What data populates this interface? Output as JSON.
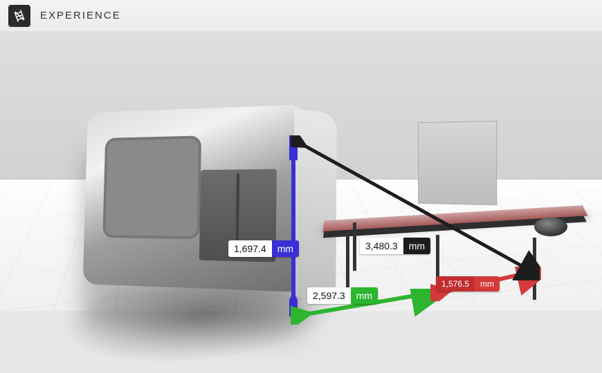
{
  "header": {
    "title": "EXPERIENCE",
    "logo_icon": "ladder-icon"
  },
  "measurements": {
    "height": {
      "value": "1,697.4",
      "unit": "mm"
    },
    "depth": {
      "value": "2,597.3",
      "unit": "mm"
    },
    "diagonal": {
      "value": "3,480.3",
      "unit": "mm"
    },
    "width": {
      "value": "1,576.5",
      "unit": "mm"
    }
  },
  "colors": {
    "axis_y": "#3a2fd6",
    "axis_x": "#2db52f",
    "axis_z": "#d43a3a",
    "diag": "#1d1d1d"
  }
}
